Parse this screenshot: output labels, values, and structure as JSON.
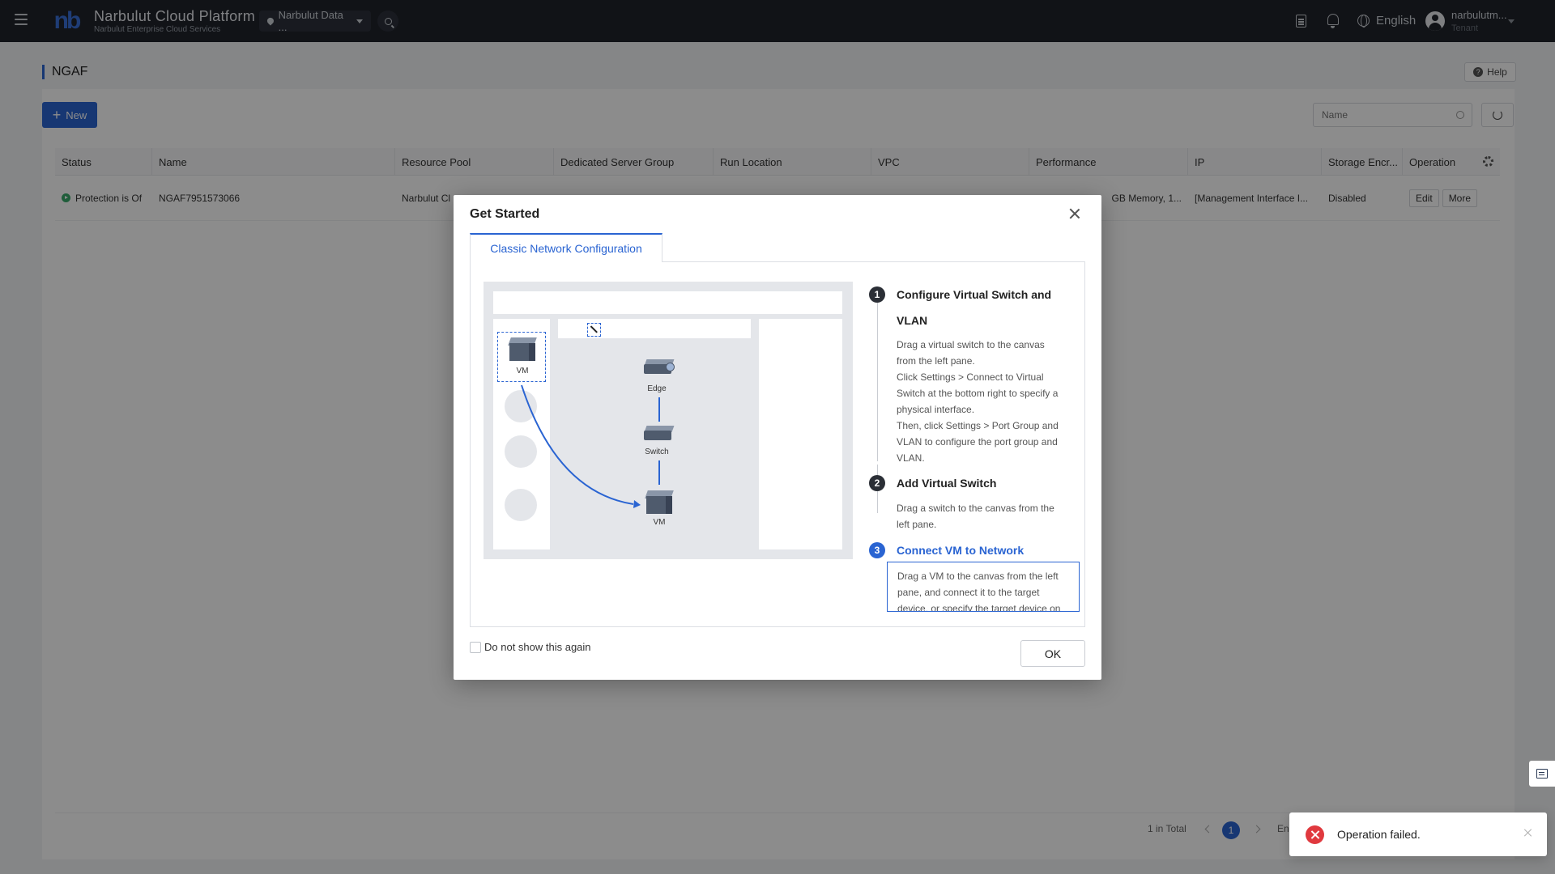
{
  "header": {
    "brand_title": "Narbulut Cloud Platform",
    "brand_subtitle": "Narbulut Enterprise Cloud Services",
    "logo_text": "nb",
    "region": "Narbulut Data ...",
    "language": "English",
    "user_name": "narbulutm...",
    "user_role": "Tenant"
  },
  "page": {
    "title": "NGAF",
    "help_label": "Help",
    "new_label": "New",
    "search_placeholder": "Name"
  },
  "table": {
    "columns": [
      "Status",
      "Name",
      "Resource Pool",
      "Dedicated Server Group",
      "Run Location",
      "VPC",
      "Performance",
      "IP",
      "Storage Encr...",
      "Operation"
    ],
    "rows": [
      {
        "status": "Protection is Of",
        "name": "NGAF7951573066",
        "resource_pool": "Narbulut Cl",
        "performance": "GB Memory, 1...",
        "ip": "[Management Interface I...",
        "storage": "Disabled",
        "edit_label": "Edit",
        "more_label": "More"
      }
    ]
  },
  "pagination": {
    "total": "1 in Total",
    "current_page": "1",
    "jump_text": "En"
  },
  "modal": {
    "title": "Get Started",
    "tab_label": "Classic Network Configuration",
    "illustration": {
      "vm_label": "VM",
      "edge_label": "Edge",
      "switch_label": "Switch",
      "vm_target_label": "VM"
    },
    "steps": [
      {
        "num": "1",
        "title_line1": "Configure Virtual Switch and",
        "title_line2": "VLAN",
        "desc": [
          "Drag a virtual switch to the canvas",
          "from the left pane.",
          "Click Settings > Connect to Virtual",
          "Switch at the bottom right to specify a",
          "physical interface.",
          "Then, click Settings > Port Group and",
          "VLAN to configure the port group and",
          "VLAN."
        ]
      },
      {
        "num": "2",
        "title_line1": "Add Virtual Switch",
        "desc": [
          "Drag a switch to the canvas from the",
          "left pane."
        ]
      },
      {
        "num": "3",
        "title_line1": "Connect VM to Network",
        "desc": [
          "Drag a VM to the canvas from the left",
          "pane, and connect it to the target",
          "device, or specify the target device on"
        ]
      }
    ],
    "checkbox_label": "Do not show this again",
    "ok_label": "OK"
  },
  "toast": {
    "message": "Operation failed."
  },
  "colors": {
    "accent": "#2a64d2",
    "topbar": "#1f232b",
    "error": "#e0393e",
    "status_ok": "#39a96b"
  }
}
